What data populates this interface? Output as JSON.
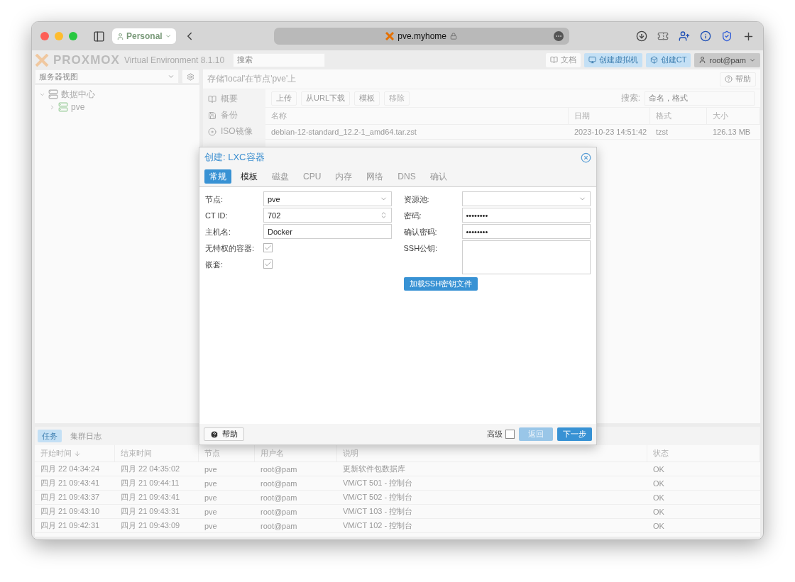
{
  "browser": {
    "profile": "Personal",
    "url": "pve.myhome"
  },
  "header": {
    "logo": "PROXMOX",
    "product": "Virtual Environment 8.1.10",
    "search": {
      "placeholder": "搜索"
    },
    "buttons": [
      {
        "label": "文档",
        "kind": "docs"
      },
      {
        "label": "创建虚拟机",
        "kind": "vm"
      },
      {
        "label": "创建CT",
        "kind": "ct"
      }
    ],
    "user": "root@pam"
  },
  "sidebar": {
    "view": "服务器视图",
    "tree": [
      {
        "label": "数据中心",
        "kind": "datacenter",
        "expanded": true,
        "children": [
          {
            "label": "pve",
            "kind": "node",
            "expanded": false
          }
        ]
      }
    ]
  },
  "content": {
    "title": "存储'local'在节点'pve'上",
    "help": "帮助",
    "nav": [
      {
        "label": "概要",
        "kind": "book"
      },
      {
        "label": "备份",
        "kind": "floppy"
      },
      {
        "label": "ISO镜像",
        "kind": "disc"
      }
    ],
    "toolbar": [
      {
        "label": "上传",
        "disabled": false
      },
      {
        "label": "从URL下载",
        "disabled": false
      },
      {
        "label": "模板",
        "disabled": false
      },
      {
        "label": "移除",
        "disabled": true
      }
    ],
    "search_label": "搜索:",
    "search": {
      "placeholder": "命名，格式"
    },
    "table": {
      "columns": [
        "名称",
        "日期",
        "格式",
        "大小"
      ],
      "rows": [
        [
          "debian-12-standard_12.2-1_amd64.tar.zst",
          "2023-10-23 14:51:42",
          "tzst",
          "126.13 MB"
        ]
      ]
    }
  },
  "tasks": {
    "tabs": [
      {
        "label": "任务",
        "selected": true
      },
      {
        "label": "集群日志",
        "selected": false
      }
    ],
    "columns": [
      {
        "label": "开始时间",
        "sorted": true
      },
      {
        "label": "结束时间",
        "sorted": false
      },
      {
        "label": "节点",
        "sorted": false
      },
      {
        "label": "用户名",
        "sorted": false
      },
      {
        "label": "说明",
        "sorted": false
      },
      {
        "label": "状态",
        "sorted": false
      }
    ],
    "rows": [
      [
        "四月 22 04:34:24",
        "四月 22 04:35:02",
        "pve",
        "root@pam",
        "更新软件包数据库",
        "OK"
      ],
      [
        "四月 21 09:43:41",
        "四月 21 09:44:11",
        "pve",
        "root@pam",
        "VM/CT 501 - 控制台",
        "OK"
      ],
      [
        "四月 21 09:43:37",
        "四月 21 09:43:41",
        "pve",
        "root@pam",
        "VM/CT 502 - 控制台",
        "OK"
      ],
      [
        "四月 21 09:43:10",
        "四月 21 09:43:31",
        "pve",
        "root@pam",
        "VM/CT 103 - 控制台",
        "OK"
      ],
      [
        "四月 21 09:42:31",
        "四月 21 09:43:09",
        "pve",
        "root@pam",
        "VM/CT 102 - 控制台",
        "OK"
      ]
    ]
  },
  "dialog": {
    "title": "创建: LXC容器",
    "tabs": [
      {
        "label": "常规",
        "selected": true,
        "disabled": false
      },
      {
        "label": "模板",
        "selected": false,
        "disabled": false
      },
      {
        "label": "磁盘",
        "selected": false,
        "disabled": true
      },
      {
        "label": "CPU",
        "selected": false,
        "disabled": true
      },
      {
        "label": "内存",
        "selected": false,
        "disabled": true
      },
      {
        "label": "网络",
        "selected": false,
        "disabled": true
      },
      {
        "label": "DNS",
        "selected": false,
        "disabled": true
      },
      {
        "label": "确认",
        "selected": false,
        "disabled": true
      }
    ],
    "left_fields": [
      {
        "label": "节点:",
        "kind": "select",
        "value": "pve"
      },
      {
        "label": "CT ID:",
        "kind": "spinner",
        "value": "702"
      },
      {
        "label": "主机名:",
        "kind": "text",
        "value": "Docker"
      },
      {
        "label": "无特权的容器:",
        "kind": "checkbox",
        "checked": true
      },
      {
        "label": "嵌套:",
        "kind": "checkbox",
        "checked": true
      }
    ],
    "right_fields": [
      {
        "label": "资源池:",
        "kind": "select"
      },
      {
        "label": "密码:",
        "kind": "password",
        "value": "••••••••"
      },
      {
        "label": "确认密码:",
        "kind": "password",
        "value": "••••••••"
      },
      {
        "label": "SSH公钥:",
        "kind": "textarea"
      }
    ],
    "load_key_button": "加载SSH密钥文件",
    "help": "帮助",
    "advanced": {
      "label": "高级",
      "checked": false
    },
    "back": {
      "label": "返回",
      "disabled": true
    },
    "next": {
      "label": "下一步",
      "disabled": false
    }
  }
}
